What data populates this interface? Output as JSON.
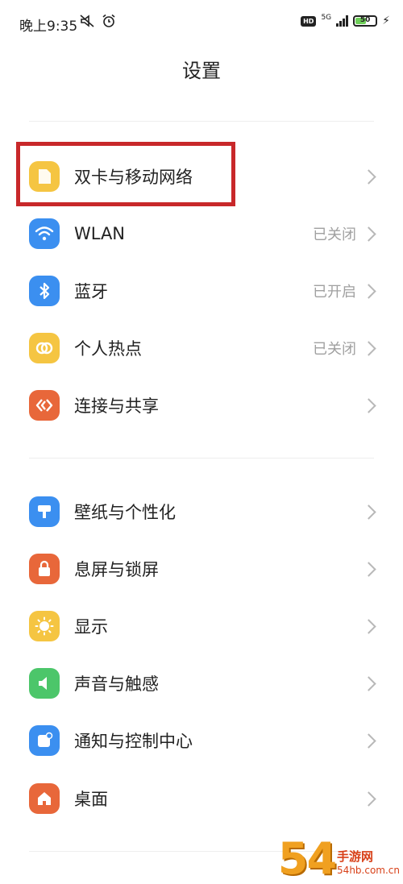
{
  "status_bar": {
    "time": "晚上9:35",
    "network": "5G",
    "battery": "50"
  },
  "header": {
    "title": "设置"
  },
  "groups": [
    {
      "items": [
        {
          "label": "双卡与移动网络",
          "status": "",
          "icon": "sim-icon",
          "color": "#f5c542"
        },
        {
          "label": "WLAN",
          "status": "已关闭",
          "icon": "wifi-icon",
          "color": "#3b8ff0"
        },
        {
          "label": "蓝牙",
          "status": "已开启",
          "icon": "bluetooth-icon",
          "color": "#3b8ff0"
        },
        {
          "label": "个人热点",
          "status": "已关闭",
          "icon": "hotspot-icon",
          "color": "#f5c542"
        },
        {
          "label": "连接与共享",
          "status": "",
          "icon": "share-icon",
          "color": "#e8673a"
        }
      ]
    },
    {
      "items": [
        {
          "label": "壁纸与个性化",
          "status": "",
          "icon": "wallpaper-icon",
          "color": "#3b8ff0"
        },
        {
          "label": "息屏与锁屏",
          "status": "",
          "icon": "lock-icon",
          "color": "#e8673a"
        },
        {
          "label": "显示",
          "status": "",
          "icon": "sun-icon",
          "color": "#f5c542"
        },
        {
          "label": "声音与触感",
          "status": "",
          "icon": "sound-icon",
          "color": "#4cc66a"
        },
        {
          "label": "通知与控制中心",
          "status": "",
          "icon": "notification-icon",
          "color": "#3b8ff0"
        },
        {
          "label": "桌面",
          "status": "",
          "icon": "home-icon",
          "color": "#e8673a"
        }
      ]
    }
  ],
  "watermark": {
    "big": "54",
    "cn": "手游网",
    "url": "54hb.com.cn"
  }
}
